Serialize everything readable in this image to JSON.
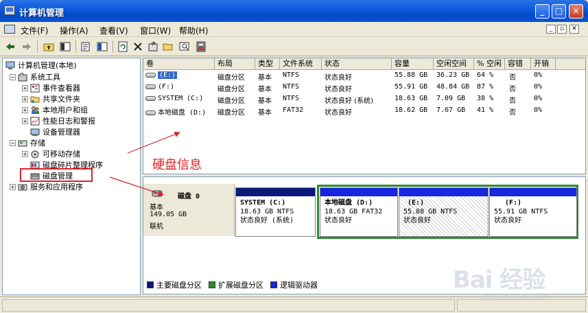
{
  "window": {
    "title": "计算机管理",
    "buttons": {
      "minimize": "_",
      "maximize": "□",
      "close": "✕"
    }
  },
  "menu": {
    "items": [
      "文件(F)",
      "操作(A)",
      "查看(V)",
      "窗口(W)",
      "帮助(H)"
    ],
    "mdi": {
      "minimize": "_",
      "restore": "▫",
      "close": "✕"
    }
  },
  "tree": {
    "root": "计算机管理(本地)",
    "system_tools": "系统工具",
    "event_viewer": "事件查看器",
    "shared_folders": "共享文件夹",
    "local_users": "本地用户和组",
    "perf_logs": "性能日志和警报",
    "device_manager": "设备管理器",
    "storage": "存储",
    "removable": "可移动存储",
    "defrag": "磁盘碎片整理程序",
    "disk_mgmt": "磁盘管理",
    "services": "服务和应用程序"
  },
  "list": {
    "columns": [
      "卷",
      "布局",
      "类型",
      "文件系统",
      "状态",
      "容量",
      "空闲空间",
      "% 空闲",
      "容错",
      "开销"
    ],
    "rows": [
      [
        "(E:)",
        "磁盘分区",
        "基本",
        "NTFS",
        "状态良好",
        "55.88 GB",
        "36.23 GB",
        "64 %",
        "否",
        "0%"
      ],
      [
        "(F:)",
        "磁盘分区",
        "基本",
        "NTFS",
        "状态良好",
        "55.91 GB",
        "48.84 GB",
        "87 %",
        "否",
        "0%"
      ],
      [
        "SYSTEM (C:)",
        "磁盘分区",
        "基本",
        "NTFS",
        "状态良好 (系统)",
        "18.63 GB",
        "7.09 GB",
        "38 %",
        "否",
        "0%"
      ],
      [
        "本地磁盘 (D:)",
        "磁盘分区",
        "基本",
        "FAT32",
        "状态良好",
        "18.62 GB",
        "7.67 GB",
        "41 %",
        "否",
        "0%"
      ]
    ]
  },
  "disk": {
    "name": "磁盘 0",
    "type": "基本",
    "size": "149.05 GB",
    "status": "联机",
    "partitions": [
      {
        "name": "SYSTEM  (C:)",
        "size": "18.63 GB NTFS",
        "status": "状态良好 (系统)"
      },
      {
        "name": "本地磁盘  (D:)",
        "size": "18.63 GB FAT32",
        "status": "状态良好"
      },
      {
        "name": "(E:)",
        "size": "55.88 GB NTFS",
        "status": "状态良好"
      },
      {
        "name": "(F:)",
        "size": "55.91 GB NTFS",
        "status": "状态良好"
      }
    ]
  },
  "legend": {
    "primary": "主要磁盘分区",
    "extended": "扩展磁盘分区",
    "logical": "逻辑驱动器",
    "colors": {
      "primary": "#0a1a7a",
      "extended": "#2d8a2d",
      "logical": "#1726e0"
    }
  },
  "annotation": {
    "text": "硬盘信息",
    "color": "#d9242a"
  },
  "watermark": {
    "logo": "Bai 经验",
    "url": "jingyan.baidu.com"
  }
}
